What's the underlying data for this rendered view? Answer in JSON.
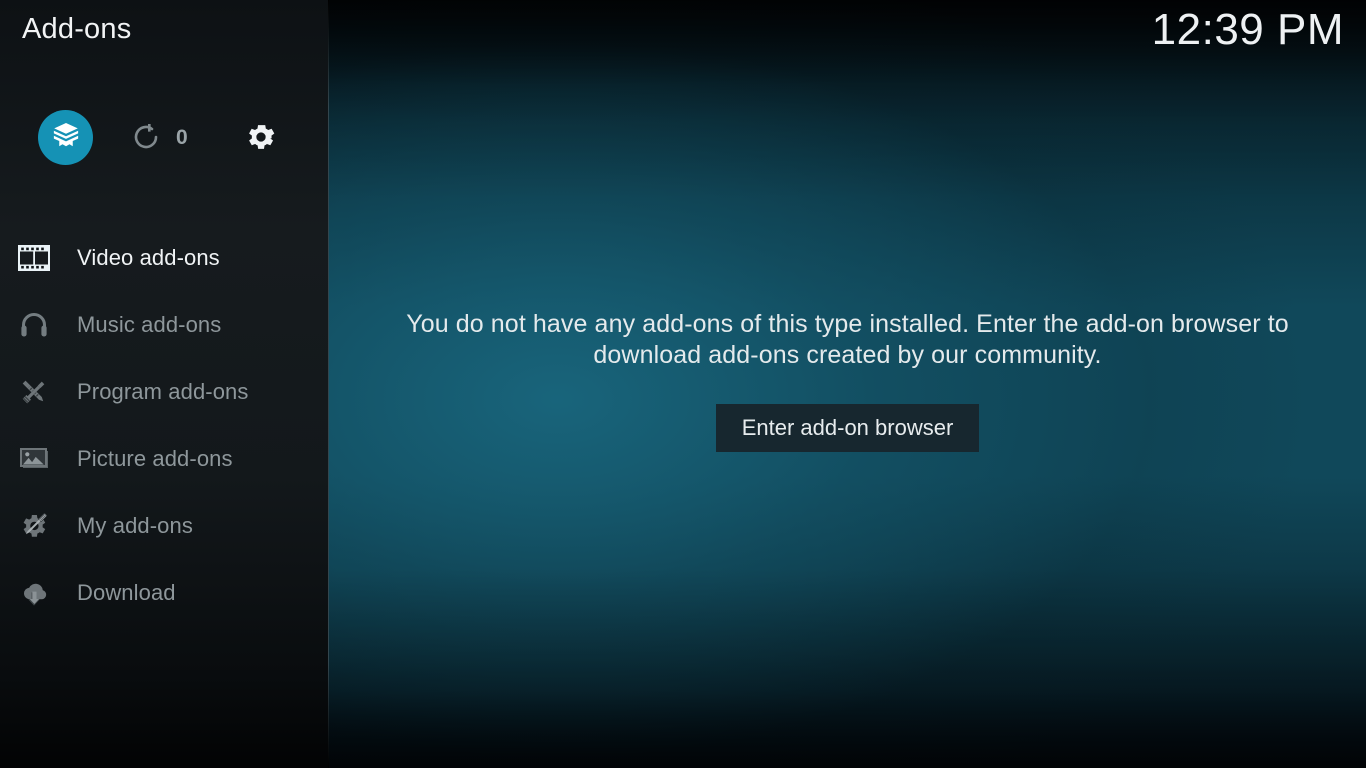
{
  "header": {
    "title": "Add-ons",
    "clock": "12:39 PM"
  },
  "toolbar": {
    "addon_browser_icon": "box-icon",
    "refresh_icon": "refresh-icon",
    "refresh_count": "0",
    "settings_icon": "gear-icon"
  },
  "sidebar": {
    "items": [
      {
        "label": "Video add-ons",
        "icon": "film-strip-icon",
        "selected": true
      },
      {
        "label": "Music add-ons",
        "icon": "headphones-icon",
        "selected": false
      },
      {
        "label": "Program add-ons",
        "icon": "pencil-wrench-icon",
        "selected": false
      },
      {
        "label": "Picture add-ons",
        "icon": "picture-icon",
        "selected": false
      },
      {
        "label": "My add-ons",
        "icon": "gear-screwdriver-icon",
        "selected": false
      },
      {
        "label": "Download",
        "icon": "cloud-download-icon",
        "selected": false
      }
    ]
  },
  "main": {
    "empty_message": "You do not have any add-ons of this type installed. Enter the add-on browser to download add-ons created by our community.",
    "enter_browser_label": "Enter add-on browser"
  },
  "colors": {
    "accent": "#1592b5",
    "sidebar_bg": "#13181b",
    "content_bg": "#10485a",
    "button_bg": "#17272f",
    "text_primary": "#f0f3f5",
    "text_muted": "#8e979b"
  }
}
